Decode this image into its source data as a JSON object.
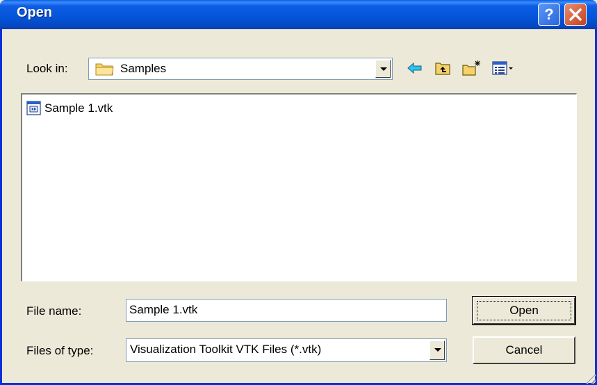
{
  "window": {
    "title": "Open",
    "help_label": "?",
    "close_label": "✕"
  },
  "look_in": {
    "label": "Look in:",
    "value": "Samples",
    "icon": "folder-icon"
  },
  "toolbar": {
    "back_icon": "back-arrow-icon",
    "up_icon": "up-folder-icon",
    "new_folder_icon": "new-folder-icon",
    "view_menu_icon": "view-menu-icon"
  },
  "files": [
    {
      "name": "Sample 1.vtk",
      "icon": "vtk-file-icon"
    }
  ],
  "file_name": {
    "label": "File name:",
    "value": "Sample 1.vtk"
  },
  "file_type": {
    "label": "Files of type:",
    "value": "Visualization Toolkit VTK Files (*.vtk)"
  },
  "buttons": {
    "open": "Open",
    "cancel": "Cancel"
  }
}
